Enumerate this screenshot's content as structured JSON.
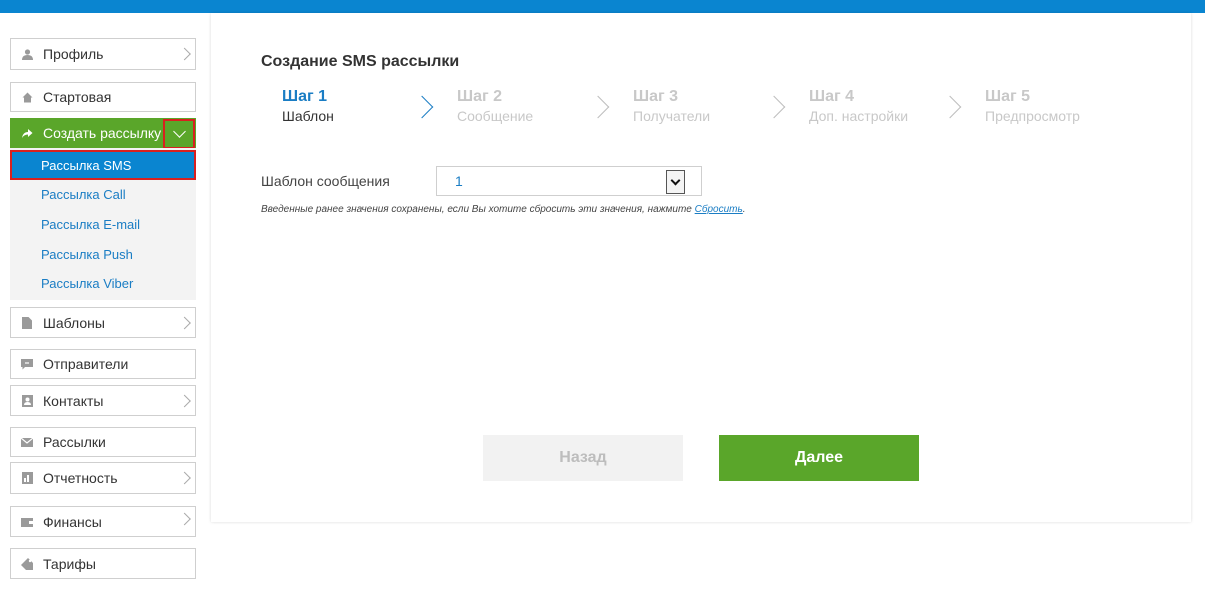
{
  "sidebar": {
    "profile": "Профиль",
    "start": "Стартовая",
    "create": "Создать рассылку",
    "sub_items": [
      "Рассылка SMS",
      "Рассылка Call",
      "Рассылка E-mail",
      "Рассылка Push",
      "Рассылка Viber"
    ],
    "templates": "Шаблоны",
    "senders": "Отправители",
    "contacts": "Контакты",
    "mailings": "Рассылки",
    "reports": "Отчетность",
    "finance": "Финансы",
    "tariffs": "Тарифы"
  },
  "main": {
    "title": "Создание SMS рассылки",
    "steps": [
      {
        "num": "Шаг 1",
        "label": "Шаблон"
      },
      {
        "num": "Шаг 2",
        "label": "Сообщение"
      },
      {
        "num": "Шаг 3",
        "label": "Получатели"
      },
      {
        "num": "Шаг 4",
        "label": "Доп. настройки"
      },
      {
        "num": "Шаг 5",
        "label": "Предпросмотр"
      }
    ],
    "template_label": "Шаблон сообщения",
    "template_value": "1",
    "hint_text": "Введенные ранее значения сохранены, если Вы хотите сбросить эти значения, нажмите ",
    "hint_link": "Сбросить",
    "hint_end": ".",
    "back": "Назад",
    "next": "Далее"
  },
  "colors": {
    "topbar": "#0a85d0",
    "green": "#5aa62a",
    "link": "#1a7dc4",
    "highlight": "#d9201f"
  }
}
